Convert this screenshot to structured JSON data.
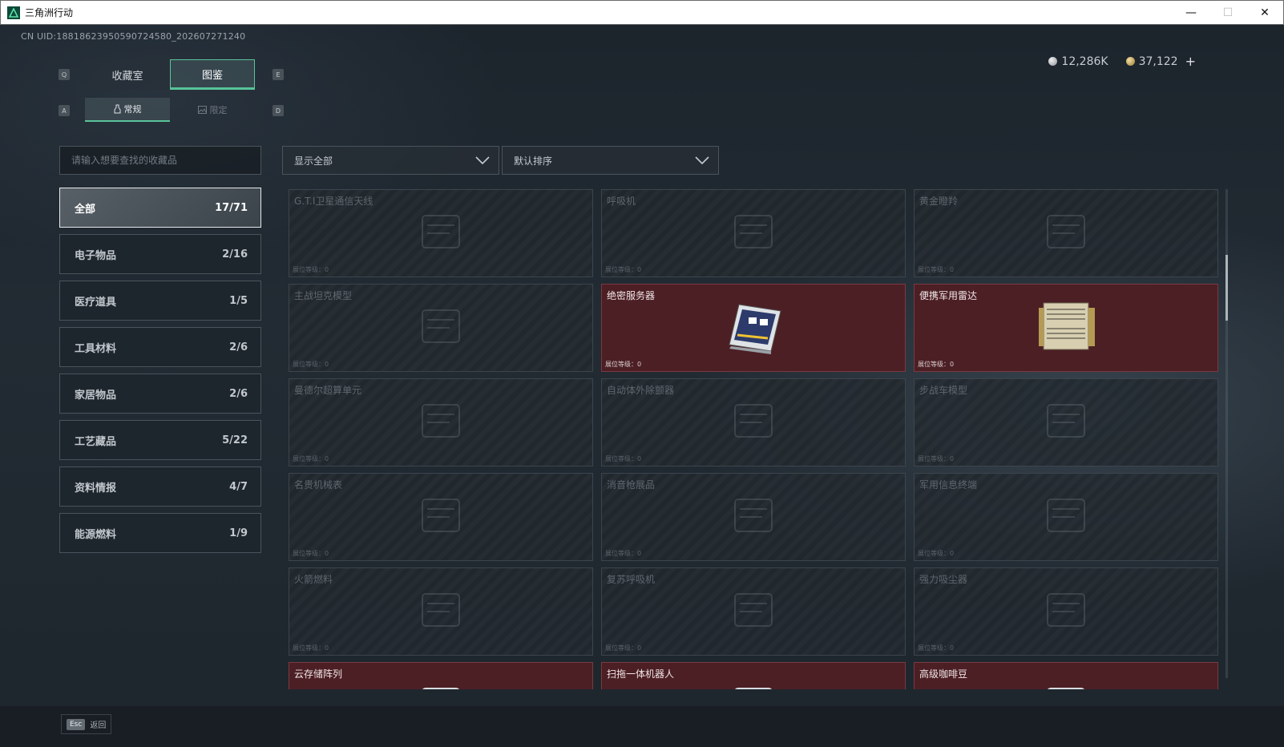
{
  "window": {
    "title": "三角洲行动",
    "minimize": "—",
    "maximize": "☐",
    "close": "✕"
  },
  "uid": "CN UID:18818623950590724580_202607271240",
  "currency": {
    "silver": "12,286K",
    "gold": "37,122",
    "add": "+"
  },
  "keys": {
    "q": "Q",
    "e": "E",
    "a": "A",
    "d": "D"
  },
  "top_tabs": [
    {
      "label": "收藏室"
    },
    {
      "label": "图鉴"
    }
  ],
  "sub_tabs": [
    {
      "label": "常规"
    },
    {
      "label": "限定"
    }
  ],
  "search": {
    "placeholder": "请输入想要查找的收藏品",
    "value": ""
  },
  "filters": {
    "show": "显示全部",
    "sort": "默认排序"
  },
  "categories": [
    {
      "label": "全部",
      "count": "17/71"
    },
    {
      "label": "电子物品",
      "count": "2/16"
    },
    {
      "label": "医疗道具",
      "count": "1/5"
    },
    {
      "label": "工具材料",
      "count": "2/6"
    },
    {
      "label": "家居物品",
      "count": "2/6"
    },
    {
      "label": "工艺藏品",
      "count": "5/22"
    },
    {
      "label": "资料情报",
      "count": "4/7"
    },
    {
      "label": "能源燃料",
      "count": "1/9"
    }
  ],
  "level_label": "展位等级：0",
  "items": [
    {
      "name": "G.T.I卫星通信天线",
      "owned": false,
      "icon": "satellite-dish-icon"
    },
    {
      "name": "呼吸机",
      "owned": false,
      "icon": "ventilator-icon"
    },
    {
      "name": "黄金瞪羚",
      "owned": false,
      "icon": "gazelle-statue-icon"
    },
    {
      "name": "主战坦克模型",
      "owned": false,
      "icon": "tank-model-icon"
    },
    {
      "name": "绝密服务器",
      "owned": true,
      "icon": "server-icon"
    },
    {
      "name": "便携军用雷达",
      "owned": true,
      "icon": "radar-icon"
    },
    {
      "name": "曼德尔超算单元",
      "owned": false,
      "icon": "supercomputer-icon"
    },
    {
      "name": "自动体外除颤器",
      "owned": false,
      "icon": "defibrillator-icon"
    },
    {
      "name": "步战车模型",
      "owned": false,
      "icon": "ifv-model-icon"
    },
    {
      "name": "名贵机械表",
      "owned": false,
      "icon": "watch-icon"
    },
    {
      "name": "消音枪展品",
      "owned": false,
      "icon": "rifle-icon"
    },
    {
      "name": "军用信息终端",
      "owned": false,
      "icon": "terminal-icon"
    },
    {
      "name": "火箭燃料",
      "owned": false,
      "icon": "fuel-can-icon"
    },
    {
      "name": "复苏呼吸机",
      "owned": false,
      "icon": "resuscitator-icon"
    },
    {
      "name": "强力吸尘器",
      "owned": false,
      "icon": "vacuum-icon"
    },
    {
      "name": "云存储阵列",
      "owned": true,
      "icon": "storage-array-icon"
    },
    {
      "name": "扫拖一体机器人",
      "owned": true,
      "icon": "robot-vacuum-icon"
    },
    {
      "name": "高级咖啡豆",
      "owned": true,
      "icon": "coffee-beans-icon"
    }
  ],
  "footer": {
    "esc": "Esc",
    "back": "返回"
  }
}
